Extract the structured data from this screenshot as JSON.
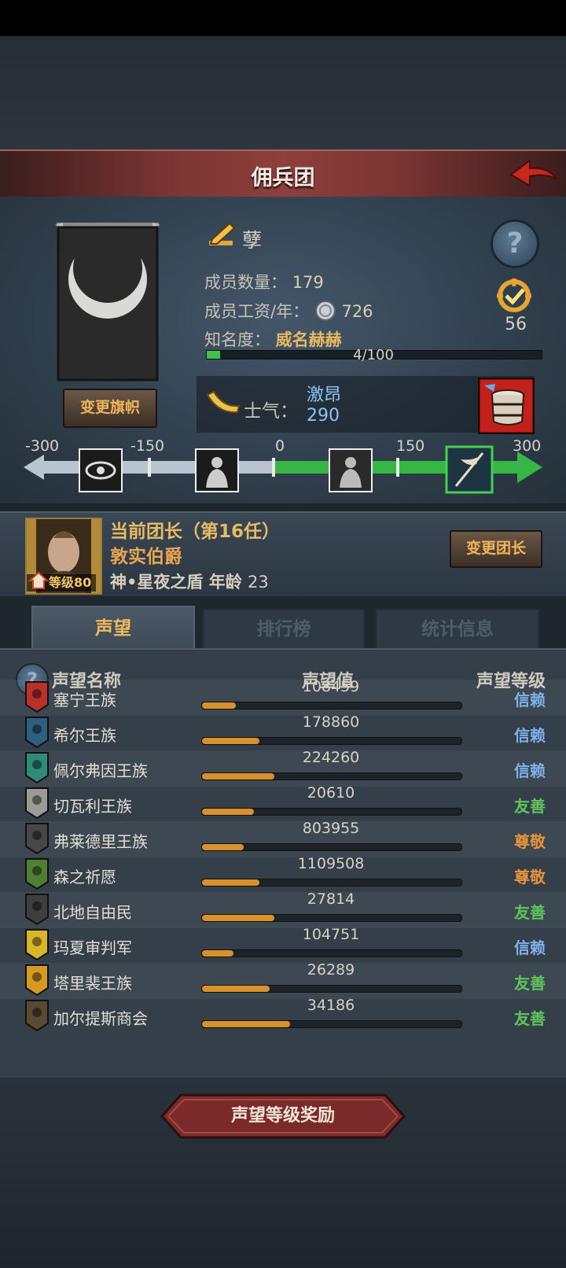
{
  "header": {
    "title": "佣兵团"
  },
  "company": {
    "name": "孽",
    "members_label": "成员数量：",
    "members_value": "179",
    "wage_label": "成员工资/年：",
    "wage_value": "726",
    "fame_label": "知名度：",
    "fame_value": "威名赫赫",
    "fame_progress_text": "4/100",
    "fame_progress": 0.04,
    "badge_value": "56",
    "change_flag_label": "变更旗帜"
  },
  "morale": {
    "label": "士气：",
    "word": "激昂",
    "value": "290",
    "ticks": [
      "-300",
      "-150",
      "0",
      "150",
      "300"
    ],
    "icons": [
      "eye-omen-icon",
      "despair-figure-icon",
      "calm-figure-icon",
      "charge-banner-icon"
    ]
  },
  "leader": {
    "line1": "当前团长（第16任）",
    "name": "敦实伯爵",
    "title_age": "神•星夜之盾 年龄",
    "age": "23",
    "level": "等级80",
    "change_leader_label": "变更团长"
  },
  "tabs": [
    {
      "label": "声望",
      "active": true
    },
    {
      "label": "排行榜",
      "active": false
    },
    {
      "label": "统计信息",
      "active": false
    }
  ],
  "reputation": {
    "col_name": "声望名称",
    "col_value": "声望值",
    "col_level": "声望等级",
    "rows": [
      {
        "name": "塞宁王族",
        "value": "108459",
        "progress": 0.13,
        "level": "信赖",
        "level_color": "#7fb0ea",
        "icon_color": "#b8322a"
      },
      {
        "name": "希尔王族",
        "value": "178860",
        "progress": 0.22,
        "level": "信赖",
        "level_color": "#7fb0ea",
        "icon_color": "#2f5f7e"
      },
      {
        "name": "佩尔弗因王族",
        "value": "224260",
        "progress": 0.28,
        "level": "信赖",
        "level_color": "#7fb0ea",
        "icon_color": "#2f8a7a"
      },
      {
        "name": "切瓦利王族",
        "value": "20610",
        "progress": 0.2,
        "level": "友善",
        "level_color": "#5ec45c",
        "icon_color": "#9a9a96"
      },
      {
        "name": "弗莱德里王族",
        "value": "803955",
        "progress": 0.16,
        "level": "尊敬",
        "level_color": "#e5943a",
        "icon_color": "#474747"
      },
      {
        "name": "森之祈愿",
        "value": "1109508",
        "progress": 0.22,
        "level": "尊敬",
        "level_color": "#e5943a",
        "icon_color": "#4f7e34"
      },
      {
        "name": "北地自由民",
        "value": "27814",
        "progress": 0.28,
        "level": "友善",
        "level_color": "#5ec45c",
        "icon_color": "#3e3e3e"
      },
      {
        "name": "玛夏审判军",
        "value": "104751",
        "progress": 0.12,
        "level": "信赖",
        "level_color": "#7fb0ea",
        "icon_color": "#d8b62a"
      },
      {
        "name": "塔里裴王族",
        "value": "26289",
        "progress": 0.26,
        "level": "友善",
        "level_color": "#5ec45c",
        "icon_color": "#d49a22"
      },
      {
        "name": "加尔提斯商会",
        "value": "34186",
        "progress": 0.34,
        "level": "友善",
        "level_color": "#5ec45c",
        "icon_color": "#5a4a34"
      }
    ]
  },
  "footer": {
    "reward_label": "声望等级奖励"
  }
}
